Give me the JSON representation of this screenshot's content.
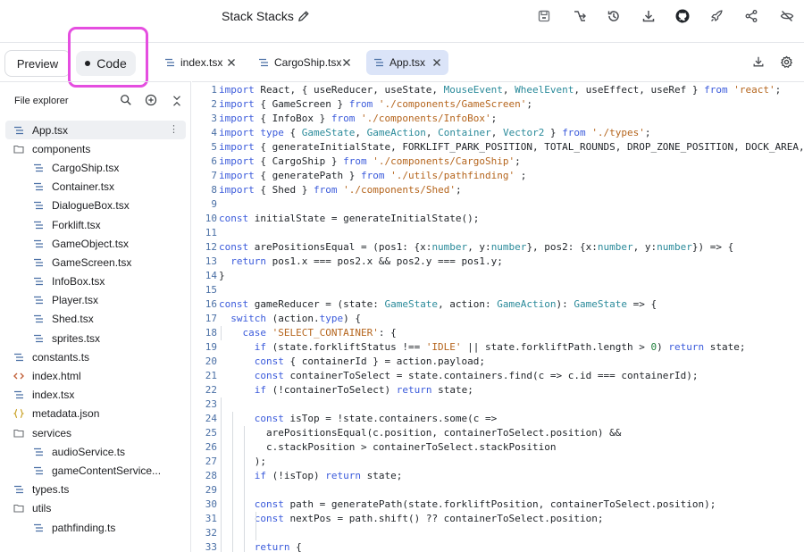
{
  "app": {
    "title": "Stack Stacks"
  },
  "toolbar": {
    "icons": [
      "save-icon",
      "share-branch-icon",
      "history-icon",
      "download-icon",
      "github-icon",
      "deploy-rocket-icon",
      "share-icon",
      "hide-icon"
    ]
  },
  "tabs": {
    "preview_label": "Preview",
    "code_label": "Code",
    "files": [
      {
        "label": "index.tsx",
        "active": false
      },
      {
        "label": "CargoShip.tsx",
        "active": false
      },
      {
        "label": "App.tsx",
        "active": true
      }
    ]
  },
  "explorer": {
    "title": "File explorer",
    "tree": [
      {
        "label": "App.tsx",
        "type": "file",
        "indent": 0,
        "selected": true
      },
      {
        "label": "components",
        "type": "folder",
        "indent": 0
      },
      {
        "label": "CargoShip.tsx",
        "type": "file",
        "indent": 1
      },
      {
        "label": "Container.tsx",
        "type": "file",
        "indent": 1
      },
      {
        "label": "DialogueBox.tsx",
        "type": "file",
        "indent": 1
      },
      {
        "label": "Forklift.tsx",
        "type": "file",
        "indent": 1
      },
      {
        "label": "GameObject.tsx",
        "type": "file",
        "indent": 1
      },
      {
        "label": "GameScreen.tsx",
        "type": "file",
        "indent": 1
      },
      {
        "label": "InfoBox.tsx",
        "type": "file",
        "indent": 1
      },
      {
        "label": "Player.tsx",
        "type": "file",
        "indent": 1
      },
      {
        "label": "Shed.tsx",
        "type": "file",
        "indent": 1
      },
      {
        "label": "sprites.tsx",
        "type": "file",
        "indent": 1
      },
      {
        "label": "constants.ts",
        "type": "file",
        "indent": 0
      },
      {
        "label": "index.html",
        "type": "html",
        "indent": 0
      },
      {
        "label": "index.tsx",
        "type": "file",
        "indent": 0
      },
      {
        "label": "metadata.json",
        "type": "json",
        "indent": 0
      },
      {
        "label": "services",
        "type": "folder",
        "indent": 0
      },
      {
        "label": "audioService.ts",
        "type": "file",
        "indent": 1
      },
      {
        "label": "gameContentService...",
        "type": "file",
        "indent": 1
      },
      {
        "label": "types.ts",
        "type": "file",
        "indent": 0
      },
      {
        "label": "utils",
        "type": "folder",
        "indent": 0
      },
      {
        "label": "pathfinding.ts",
        "type": "file",
        "indent": 1
      }
    ]
  },
  "editor": {
    "line_numbers": [
      "1",
      "2",
      "3",
      "4",
      "5",
      "6",
      "7",
      "8",
      "9",
      "10",
      "11",
      "12",
      "13",
      "14",
      "15",
      "16",
      "17",
      "18",
      "19",
      "20",
      "21",
      "22",
      "23",
      "24",
      "25",
      "26",
      "27",
      "28",
      "29",
      "30",
      "31",
      "32",
      "33"
    ],
    "lines": [
      "import React, { useReducer, useState, MouseEvent, WheelEvent, useEffect, useRef } from 'react';",
      "import { GameScreen } from './components/GameScreen';",
      "import { InfoBox } from './components/InfoBox';",
      "import type { GameState, GameAction, Container, Vector2 } from './types';",
      "import { generateInitialState, FORKLIFT_PARK_POSITION, TOTAL_ROUNDS, DROP_ZONE_POSITION, DOCK_AREA, ge",
      "import { CargoShip } from './components/CargoShip';",
      "import { generatePath } from './utils/pathfinding' ;",
      "import { Shed } from './components/Shed';",
      "",
      "const initialState = generateInitialState();",
      "",
      "const arePositionsEqual = (pos1: {x:number, y:number}, pos2: {x:number, y:number}) => {",
      "  return pos1.x === pos2.x && pos2.y === pos1.y;",
      "}",
      "",
      "const gameReducer = (state: GameState, action: GameAction): GameState => {",
      "  switch (action.type) {",
      "    case 'SELECT_CONTAINER': {",
      "      if (state.forkliftStatus !== 'IDLE' || state.forkliftPath.length > 0) return state;",
      "      const { containerId } = action.payload;",
      "      const containerToSelect = state.containers.find(c => c.id === containerId);",
      "      if (!containerToSelect) return state;",
      "",
      "      const isTop = !state.containers.some(c =>",
      "        arePositionsEqual(c.position, containerToSelect.position) &&",
      "        c.stackPosition > containerToSelect.stackPosition",
      "      );",
      "      if (!isTop) return state;",
      "",
      "      const path = generatePath(state.forkliftPosition, containerToSelect.position);",
      "      const nextPos = path.shift() ?? containerToSelect.position;",
      "",
      "      return {"
    ]
  }
}
